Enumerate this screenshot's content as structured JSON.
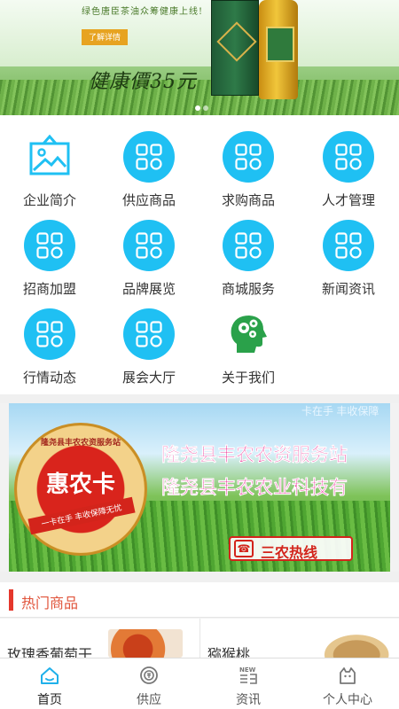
{
  "banner": {
    "slogan": "绿色唐臣茶油众筹健康上线!",
    "detail_button": "了解详情",
    "price_text": "健康價35元",
    "slide_count": 2,
    "active_slide": 1
  },
  "grid": {
    "icon_color": "#1fc0f3",
    "items": [
      {
        "label": "企业简介",
        "icon": "picture-frame-icon"
      },
      {
        "label": "供应商品",
        "icon": "grid-icon"
      },
      {
        "label": "求购商品",
        "icon": "grid-icon"
      },
      {
        "label": "人才管理",
        "icon": "grid-icon"
      },
      {
        "label": "招商加盟",
        "icon": "grid-icon"
      },
      {
        "label": "品牌展览",
        "icon": "grid-icon"
      },
      {
        "label": "商城服务",
        "icon": "grid-icon"
      },
      {
        "label": "新闻资讯",
        "icon": "grid-icon"
      },
      {
        "label": "行情动态",
        "icon": "grid-icon"
      },
      {
        "label": "展会大厅",
        "icon": "grid-icon"
      },
      {
        "label": "关于我们",
        "icon": "head-gears-icon"
      }
    ]
  },
  "promo": {
    "top_text": "卡在手 丰收保障",
    "card_title": "惠农卡",
    "arc_text": "隆尧县丰农农资服务站",
    "ribbon_text": "一卡在手 丰收保障无忧",
    "line1": "隆尧县丰农农资服务站",
    "line2": "隆尧县丰农农业科技有",
    "hotline": "三农热线"
  },
  "hot": {
    "title": "热门商品",
    "accent": "#e5372c",
    "products": [
      {
        "name": "玫瑰香葡萄干"
      },
      {
        "name": "猕猴桃"
      }
    ]
  },
  "tabbar": {
    "tabs": [
      {
        "label": "首页",
        "icon": "home-icon",
        "active": true
      },
      {
        "label": "供应",
        "icon": "supply-icon"
      },
      {
        "label": "资讯",
        "icon": "news-icon",
        "badge": "NEW"
      },
      {
        "label": "个人中心",
        "icon": "profile-icon"
      }
    ]
  }
}
